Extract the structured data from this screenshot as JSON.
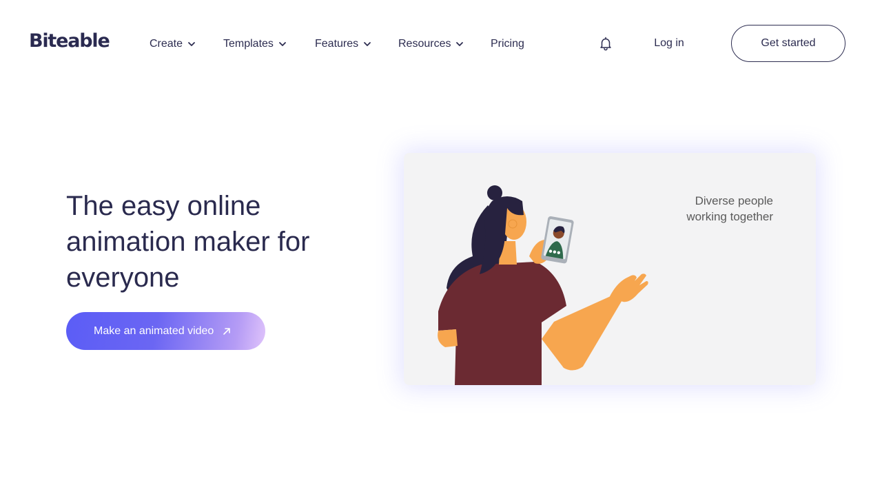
{
  "brand": {
    "name": "Biteable"
  },
  "nav": {
    "items": [
      {
        "label": "Create",
        "has_dropdown": true
      },
      {
        "label": "Templates",
        "has_dropdown": true
      },
      {
        "label": "Features",
        "has_dropdown": true
      },
      {
        "label": "Resources",
        "has_dropdown": true
      },
      {
        "label": "Pricing",
        "has_dropdown": false
      }
    ]
  },
  "header": {
    "notifications_icon": "bell-icon",
    "login_label": "Log in",
    "get_started_label": "Get started"
  },
  "hero": {
    "title": "The easy online animation maker for everyone",
    "cta_label": "Make an animated video",
    "cta_icon": "arrow-up-right-icon"
  },
  "illustration": {
    "caption_line1": "Diverse people",
    "caption_line2": "working together"
  },
  "colors": {
    "text_dark": "#2a2a4e",
    "cta_gradient_start": "#5b5df6",
    "cta_gradient_end": "#e0c4fb",
    "card_background": "#f3f3f4",
    "shirt": "#6b2a32",
    "skin": "#f7a64f",
    "hair": "#27223f"
  }
}
